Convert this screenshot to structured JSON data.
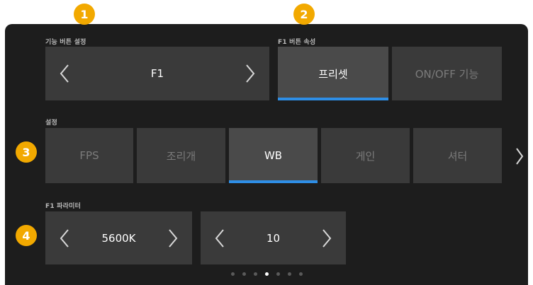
{
  "badges": [
    "1",
    "2",
    "3",
    "4"
  ],
  "function_button": {
    "label": "기능 버튼 설정",
    "value": "F1"
  },
  "f1_attribute": {
    "label": "F1 버튼 속성",
    "options": [
      "프리셋",
      "ON/OFF 기능"
    ],
    "selected": 0
  },
  "settings": {
    "label": "설정",
    "items": [
      "FPS",
      "조리개",
      "WB",
      "게인",
      "셔터"
    ],
    "selected": 2
  },
  "f1_params": {
    "label": "F1 파라미터",
    "param1": "5600K",
    "param2": "10"
  },
  "page_dots": {
    "count": 7,
    "active": 3
  },
  "colors": {
    "accent": "#2e8ee6",
    "badge": "#f2a900",
    "panel": "#1d1d1d",
    "tile": "#3a3a3a"
  },
  "icons": [
    "chevron-left-icon",
    "chevron-right-icon"
  ]
}
